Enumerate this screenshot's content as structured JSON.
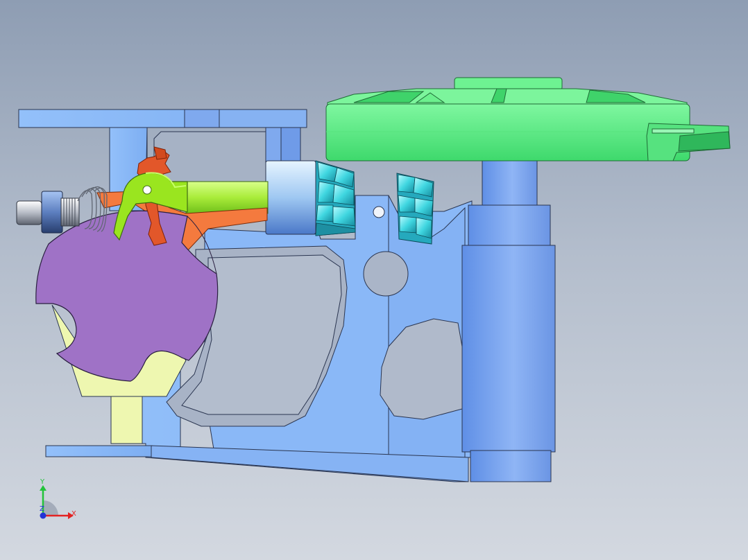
{
  "viewport": {
    "background_top": "#8e9db3",
    "background_bottom": "#d3d8e0"
  },
  "colors": {
    "frame": "#8ab8f7",
    "frame_dark": "#6f9ee6",
    "gear_green": "#5ff28a",
    "bevel_gear": "#3fd6e0",
    "star_wheel": "#9f72c6",
    "support": "#eef7b0",
    "driver_orange": "#f47a3e",
    "pawl_green": "#9ae51f",
    "shaft_green": "#b6f04a",
    "pawl_red": "#e2572a",
    "spindle_blue": "#6a95e8"
  },
  "triad": {
    "x_label": "X",
    "y_label": "Y",
    "z_label": "Z",
    "x_color": "#e32222",
    "y_color": "#22c33a",
    "z_color": "#2233d6"
  }
}
